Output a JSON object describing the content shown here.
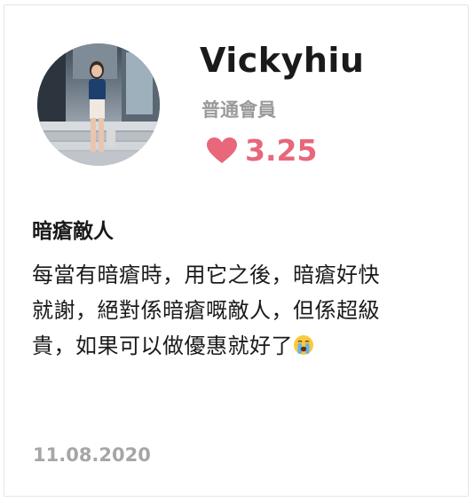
{
  "review": {
    "user": {
      "name": "Vickyhiu",
      "member_level": "普通會員",
      "avatar_icon": "user-photo-avatar"
    },
    "rating": {
      "icon": "heart-icon",
      "value": "3.25",
      "color": "#e8677a"
    },
    "title": "暗瘡敵人",
    "body_lines": [
      "每當有暗瘡時，用它之後，暗瘡好快",
      "就謝，絕對係暗瘡嘅敵人，但係超級",
      "貴，如果可以做優惠就好了"
    ],
    "body_emoji": "crying-face-emoji",
    "date": "11.08.2020"
  }
}
